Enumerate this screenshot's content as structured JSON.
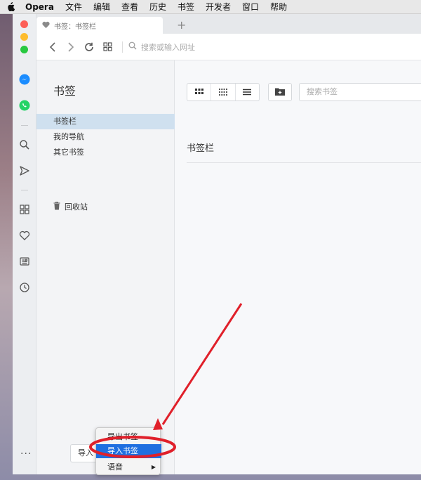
{
  "menubar": {
    "app_name": "Opera",
    "items": [
      "文件",
      "编辑",
      "查看",
      "历史",
      "书签",
      "开发者",
      "窗口",
      "帮助"
    ]
  },
  "tab": {
    "label": "书签：书签栏"
  },
  "address": {
    "placeholder": "搜索或输入网址"
  },
  "bookmarks": {
    "title": "书签",
    "nav": [
      "书签栏",
      "我的导航",
      "其它书签"
    ],
    "trash": "回收站",
    "search_placeholder": "搜索书签",
    "folder_heading": "书签栏"
  },
  "bottom": {
    "import_button": "导入"
  },
  "context_menu": {
    "items": [
      "导出书签",
      "导入书签",
      "语音"
    ],
    "selected": "导入书签"
  },
  "colors": {
    "accent_selection": "#1f6fe0",
    "annotation_red": "#e0202a",
    "active_nav": "#cfe0ef"
  }
}
